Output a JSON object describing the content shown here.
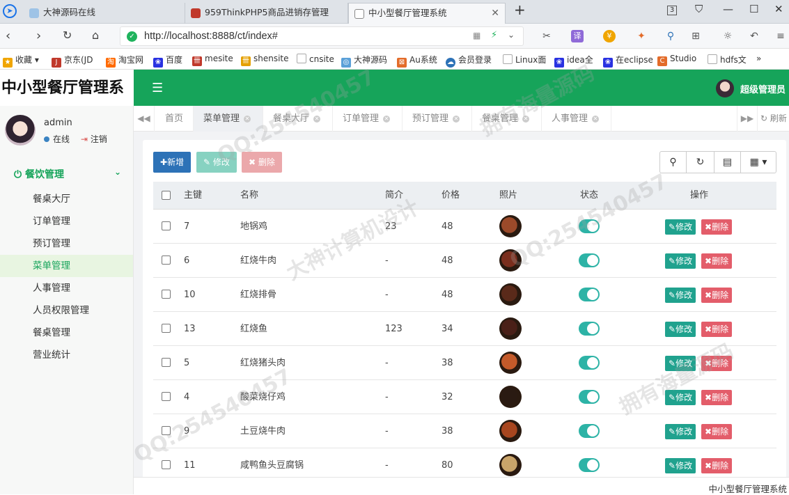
{
  "browser": {
    "tabs": [
      {
        "label": "大神源码在线",
        "active": false
      },
      {
        "label": "959ThinkPHP5商品进销存管理",
        "active": false
      },
      {
        "label": "中小型餐厅管理系统",
        "active": true
      }
    ],
    "tab_count_badge": "3",
    "url": "http://localhost:8888/ct/index#",
    "bookmarks": [
      "收藏",
      "京东(JD",
      "淘宝网",
      "百度",
      "mesite",
      "shensite",
      "cnsite",
      "大神源码",
      "Au系统",
      "会员登录",
      "Linux面",
      "idea全",
      "在eclipse",
      "Studio",
      "hdfs文"
    ],
    "bookmarks_more": "»"
  },
  "app": {
    "title": "中小型餐厅管理系统",
    "menu_icon": "hamburger-icon",
    "top_user": "超级管理员",
    "footer": "中小型餐厅管理系统",
    "accent": "#16a45a"
  },
  "sidebar": {
    "username": "admin",
    "status": "在线",
    "logout": "注销",
    "group": "餐饮管理",
    "items": [
      {
        "label": "餐桌大厅"
      },
      {
        "label": "订单管理"
      },
      {
        "label": "预订管理"
      },
      {
        "label": "菜单管理",
        "active": true
      },
      {
        "label": "人事管理"
      },
      {
        "label": "人员权限管理"
      },
      {
        "label": "餐桌管理"
      },
      {
        "label": "营业统计"
      }
    ]
  },
  "page_tabs": {
    "items": [
      {
        "label": "首页",
        "closable": false
      },
      {
        "label": "菜单管理",
        "closable": true,
        "active": true
      },
      {
        "label": "餐桌大厅",
        "closable": true
      },
      {
        "label": "订单管理",
        "closable": true
      },
      {
        "label": "预订管理",
        "closable": true
      },
      {
        "label": "餐桌管理",
        "closable": true
      },
      {
        "label": "人事管理",
        "closable": true
      }
    ],
    "refresh": "刷新"
  },
  "toolbar": {
    "add": "新增",
    "edit": "修改",
    "delete": "删除"
  },
  "table": {
    "columns": [
      "主键",
      "名称",
      "简介",
      "价格",
      "照片",
      "状态",
      "操作"
    ],
    "rows": [
      {
        "id": "7",
        "name": "地锅鸡",
        "intro": "23",
        "price": "48",
        "status": true,
        "color": "#9b4a2a"
      },
      {
        "id": "6",
        "name": "红烧牛肉",
        "intro": "-",
        "price": "48",
        "status": true,
        "color": "#7a2e1d"
      },
      {
        "id": "10",
        "name": "红烧排骨",
        "intro": "-",
        "price": "48",
        "status": true,
        "color": "#5a2a1a"
      },
      {
        "id": "13",
        "name": "红烧鱼",
        "intro": "123",
        "price": "34",
        "status": true,
        "color": "#4a2018"
      },
      {
        "id": "5",
        "name": "红烧猪头肉",
        "intro": "-",
        "price": "38",
        "status": true,
        "color": "#c45a2a"
      },
      {
        "id": "4",
        "name": "酸菜烧仔鸡",
        "intro": "-",
        "price": "32",
        "status": true,
        "color": "#2a1a12"
      },
      {
        "id": "9",
        "name": "土豆烧牛肉",
        "intro": "-",
        "price": "38",
        "status": true,
        "color": "#a8461f"
      },
      {
        "id": "11",
        "name": "咸鸭鱼头豆腐锅",
        "intro": "-",
        "price": "80",
        "status": true,
        "color": "#c9a46a"
      }
    ],
    "row_edit": "修改",
    "row_delete": "删除"
  },
  "watermark": [
    "QQ:254540457",
    "大神计算机设计",
    "拥有海量源码"
  ]
}
